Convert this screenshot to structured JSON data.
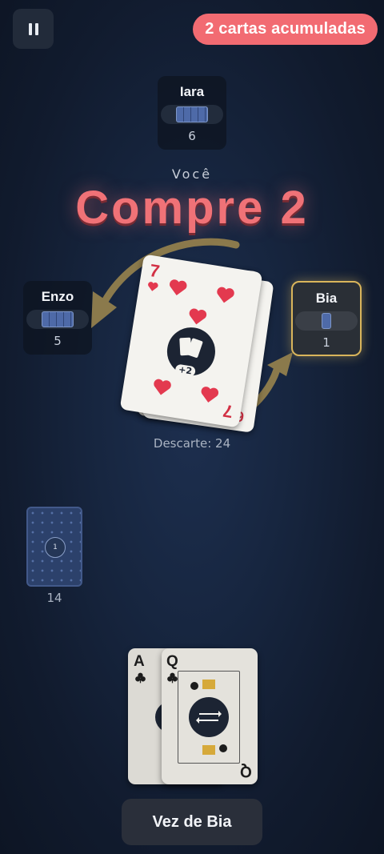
{
  "pause": {
    "icon": "pause-icon"
  },
  "stack_badge": {
    "text": "2 cartas acumuladas",
    "color": "#f26b72"
  },
  "opponents": [
    {
      "name": "Iara",
      "count": "6"
    },
    {
      "name": "Enzo",
      "count": "5"
    },
    {
      "name": "Bia",
      "count": "1",
      "active": true,
      "highlight": "#d9b55b"
    }
  ],
  "banner": {
    "player": "Você",
    "action": "Compre 2",
    "color": "#f07277"
  },
  "discard": {
    "label": "Descarte: 24",
    "top_card": {
      "rank": "7",
      "suit": "hearts",
      "effect": "+2"
    },
    "under_card_rank": "6"
  },
  "deck": {
    "count": "14",
    "badge": "1"
  },
  "hand": [
    {
      "rank": "A",
      "suit": "clubs"
    },
    {
      "rank": "Q",
      "suit": "clubs"
    }
  ],
  "turn_button": {
    "text": "Vez de Bia"
  }
}
